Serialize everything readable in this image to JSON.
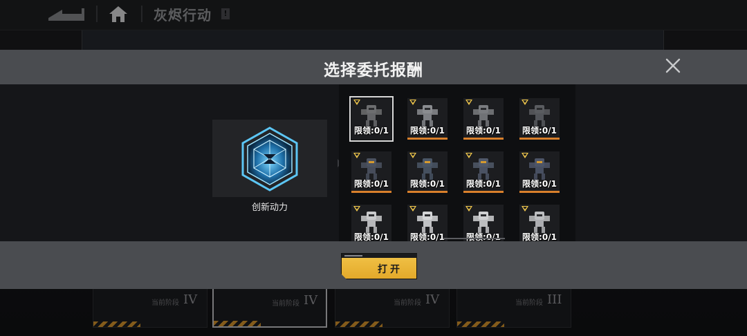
{
  "topbar": {
    "title": "灰烬行动",
    "info_mark": "!"
  },
  "background": {
    "cards": [
      {
        "stage_label": "当前阶段",
        "stage_num": "IV"
      },
      {
        "stage_label": "当前阶段",
        "stage_num": "IV"
      },
      {
        "stage_label": "当前阶段",
        "stage_num": "IV"
      },
      {
        "stage_label": "当前阶段",
        "stage_num": "III"
      }
    ]
  },
  "modal": {
    "title": "选择委托报酬",
    "preview": {
      "name": "创新动力"
    },
    "rewards": [
      {
        "limit": "限领:0/1",
        "selected": true
      },
      {
        "limit": "限领:0/1"
      },
      {
        "limit": "限领:0/1"
      },
      {
        "limit": "限领:0/1"
      },
      {
        "limit": "限领:0/1"
      },
      {
        "limit": "限领:0/1"
      },
      {
        "limit": "限领:0/1"
      },
      {
        "limit": "限领:0/1"
      },
      {
        "limit": "限领:0/1"
      },
      {
        "limit": "限领:0/1"
      },
      {
        "limit": "限领:0/1"
      },
      {
        "limit": "限领:0/1"
      }
    ],
    "open_button": "打开"
  },
  "colors": {
    "accent": "#e3a92a",
    "rarity_bar": "#d9802b",
    "header_bg": "#4a4c50"
  }
}
